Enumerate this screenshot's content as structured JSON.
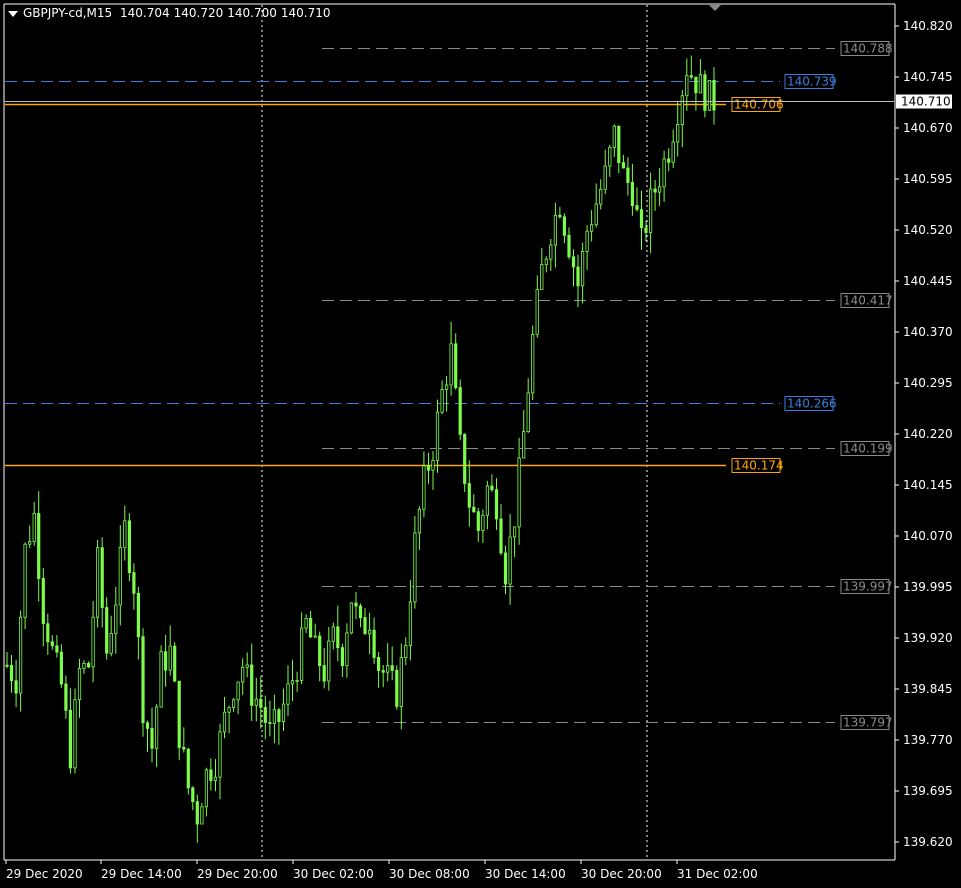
{
  "header": {
    "symbol": "GBPJPY-cd,M15",
    "open": "140.704",
    "high": "140.720",
    "low": "140.700",
    "close": "140.710"
  },
  "colors": {
    "background": "#000000",
    "candle": "#7CFC4A",
    "grid_vertical": "#ffffff",
    "axis_text": "#ffffff",
    "orange_line": "#FFA500",
    "blue_line": "#3B7DDD",
    "gray_line": "#8a8a8a",
    "current_price_line": "#bfbfbf"
  },
  "chart_data": {
    "type": "candlestick",
    "title": "",
    "xlabel": "",
    "ylabel": "",
    "ylim": [
      139.59,
      140.848
    ],
    "y_ticks": [
      "140.820",
      "140.745",
      "140.670",
      "140.595",
      "140.520",
      "140.445",
      "140.370",
      "140.295",
      "140.220",
      "140.145",
      "140.070",
      "139.995",
      "139.920",
      "139.845",
      "139.770",
      "139.695",
      "139.620"
    ],
    "x_ticks": [
      "29 Dec 2020",
      "29 Dec 14:00",
      "29 Dec 20:00",
      "30 Dec 02:00",
      "30 Dec 08:00",
      "30 Dec 14:00",
      "30 Dec 20:00",
      "31 Dec 02:00"
    ],
    "current_price": "140.710",
    "levels": [
      {
        "value": "140.788",
        "color": "gray",
        "style": "dashed"
      },
      {
        "value": "140.739",
        "color": "blue",
        "style": "dashed"
      },
      {
        "value": "140.706",
        "color": "orange",
        "style": "solid"
      },
      {
        "value": "140.417",
        "color": "gray",
        "style": "dashed"
      },
      {
        "value": "140.266",
        "color": "blue",
        "style": "dashed"
      },
      {
        "value": "140.199",
        "color": "gray",
        "style": "dashed"
      },
      {
        "value": "140.174",
        "color": "orange",
        "style": "solid"
      },
      {
        "value": "139.997",
        "color": "gray",
        "style": "dashed"
      },
      {
        "value": "139.797",
        "color": "gray",
        "style": "dashed"
      }
    ],
    "close_path": [
      [
        0,
        139.88
      ],
      [
        2,
        139.86
      ],
      [
        4,
        140.05
      ],
      [
        6,
        140.1
      ],
      [
        8,
        139.96
      ],
      [
        10,
        139.9
      ],
      [
        12,
        139.85
      ],
      [
        14,
        139.75
      ],
      [
        16,
        139.87
      ],
      [
        18,
        139.88
      ],
      [
        20,
        140.03
      ],
      [
        22,
        139.9
      ],
      [
        24,
        139.98
      ],
      [
        26,
        140.08
      ],
      [
        28,
        140.0
      ],
      [
        30,
        139.82
      ],
      [
        32,
        139.76
      ],
      [
        34,
        139.88
      ],
      [
        36,
        139.9
      ],
      [
        38,
        139.78
      ],
      [
        40,
        139.7
      ],
      [
        42,
        139.66
      ],
      [
        44,
        139.72
      ],
      [
        46,
        139.74
      ],
      [
        48,
        139.8
      ],
      [
        50,
        139.85
      ],
      [
        52,
        139.88
      ],
      [
        54,
        139.84
      ],
      [
        56,
        139.82
      ],
      [
        58,
        139.78
      ],
      [
        60,
        139.8
      ],
      [
        62,
        139.84
      ],
      [
        64,
        139.88
      ],
      [
        66,
        139.94
      ],
      [
        68,
        139.9
      ],
      [
        70,
        139.87
      ],
      [
        72,
        139.92
      ],
      [
        74,
        139.9
      ],
      [
        76,
        139.98
      ],
      [
        78,
        139.93
      ],
      [
        80,
        139.95
      ],
      [
        82,
        139.88
      ],
      [
        84,
        139.86
      ],
      [
        86,
        139.84
      ],
      [
        88,
        139.92
      ],
      [
        90,
        140.06
      ],
      [
        92,
        140.15
      ],
      [
        94,
        140.2
      ],
      [
        96,
        140.28
      ],
      [
        98,
        140.34
      ],
      [
        100,
        140.2
      ],
      [
        102,
        140.12
      ],
      [
        104,
        140.08
      ],
      [
        106,
        140.14
      ],
      [
        108,
        140.12
      ],
      [
        110,
        140.02
      ],
      [
        112,
        140.1
      ],
      [
        114,
        140.22
      ],
      [
        116,
        140.36
      ],
      [
        118,
        140.46
      ],
      [
        120,
        140.52
      ],
      [
        122,
        140.56
      ],
      [
        124,
        140.5
      ],
      [
        126,
        140.44
      ],
      [
        128,
        140.52
      ],
      [
        130,
        140.56
      ],
      [
        132,
        140.6
      ],
      [
        134,
        140.66
      ],
      [
        136,
        140.6
      ],
      [
        138,
        140.58
      ],
      [
        140,
        140.5
      ],
      [
        142,
        140.56
      ],
      [
        144,
        140.6
      ],
      [
        146,
        140.64
      ],
      [
        148,
        140.7
      ],
      [
        150,
        140.76
      ],
      [
        152,
        140.74
      ],
      [
        154,
        140.72
      ],
      [
        156,
        140.71
      ]
    ]
  }
}
